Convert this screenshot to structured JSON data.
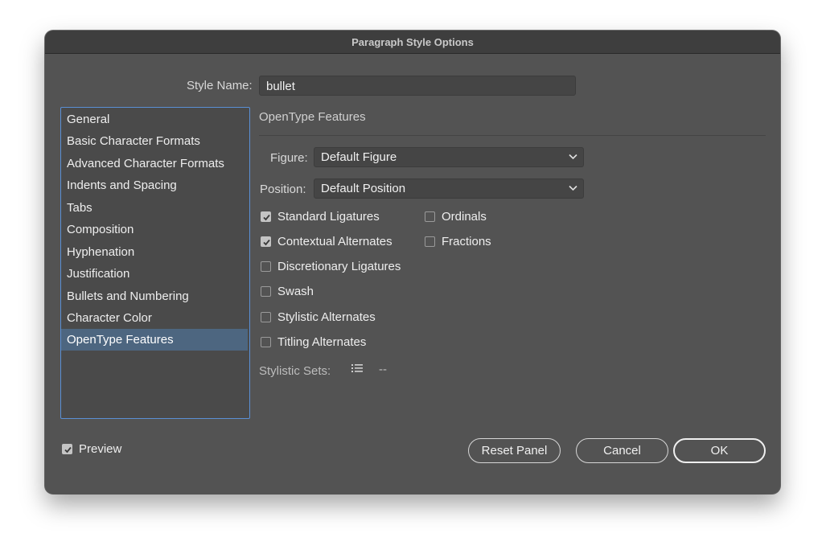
{
  "window": {
    "title": "Paragraph Style Options"
  },
  "style_name": {
    "label": "Style Name:",
    "value": "bullet"
  },
  "sidebar": {
    "items": [
      {
        "label": "General"
      },
      {
        "label": "Basic Character Formats"
      },
      {
        "label": "Advanced Character Formats"
      },
      {
        "label": "Indents and Spacing"
      },
      {
        "label": "Tabs"
      },
      {
        "label": "Composition"
      },
      {
        "label": "Hyphenation"
      },
      {
        "label": "Justification"
      },
      {
        "label": "Bullets and Numbering"
      },
      {
        "label": "Character Color"
      },
      {
        "label": "OpenType Features"
      }
    ],
    "selected": "OpenType Features",
    "selected_color": "#4d6680"
  },
  "panel": {
    "title": "OpenType Features",
    "figure": {
      "label": "Figure:",
      "value": "Default Figure"
    },
    "position": {
      "label": "Position:",
      "value": "Default Position"
    },
    "checkboxes": {
      "standard_ligatures": {
        "label": "Standard Ligatures",
        "checked": true
      },
      "contextual_alternates": {
        "label": "Contextual Alternates",
        "checked": true
      },
      "discretionary_ligatures": {
        "label": "Discretionary Ligatures",
        "checked": false
      },
      "swash": {
        "label": "Swash",
        "checked": false
      },
      "stylistic_alternates": {
        "label": "Stylistic Alternates",
        "checked": false
      },
      "titling_alternates": {
        "label": "Titling Alternates",
        "checked": false
      },
      "ordinals": {
        "label": "Ordinals",
        "checked": false
      },
      "fractions": {
        "label": "Fractions",
        "checked": false
      }
    },
    "stylistic_sets": {
      "label": "Stylistic Sets:",
      "value": "--",
      "icon": "list-icon"
    }
  },
  "footer": {
    "preview": {
      "label": "Preview",
      "checked": true
    },
    "reset_label": "Reset Panel",
    "cancel_label": "Cancel",
    "ok_label": "OK"
  }
}
